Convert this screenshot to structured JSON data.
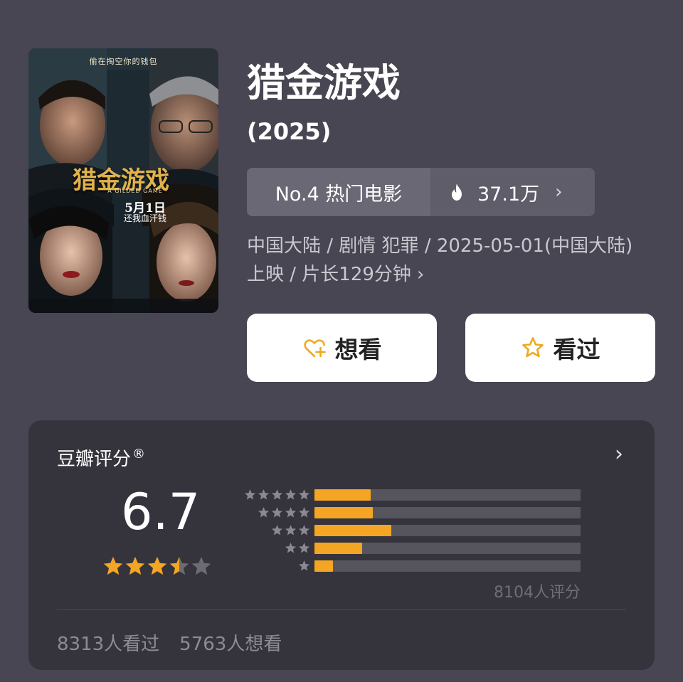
{
  "movie": {
    "title": "猎金游戏",
    "year": "(2025)",
    "poster": {
      "tagline": "偷在掏空你的钱包",
      "title": "猎金游戏",
      "english_title": "A GILDED GAME",
      "release": "5月1日",
      "release_sub": "还我血汗钱"
    },
    "rank": {
      "label": "No.4 热门电影",
      "heat_value": "37.1万",
      "heat_icon": "flame-icon",
      "chevron": "›"
    },
    "meta_text": "中国大陆 / 剧情 犯罪 / 2025-05-01(中国大陆)上映 / 片长129分钟",
    "meta_chevron": "›",
    "actions": {
      "want_label": "想看",
      "want_icon": "heart-plus-icon",
      "seen_label": "看过",
      "seen_icon": "star-outline-icon"
    }
  },
  "rating": {
    "title": "豆瓣评分",
    "registered_mark": "®",
    "chevron": "›",
    "score": "6.7",
    "stars_value": 3.5,
    "distribution": [
      {
        "stars": 5,
        "fraction": 0.21
      },
      {
        "stars": 4,
        "fraction": 0.22
      },
      {
        "stars": 3,
        "fraction": 0.29
      },
      {
        "stars": 2,
        "fraction": 0.18
      },
      {
        "stars": 1,
        "fraction": 0.07
      }
    ],
    "count_text": "8104人评分",
    "seen_count": "8313人看过",
    "want_count": "5763人想看"
  },
  "colors": {
    "background": "#484652",
    "card": "#35343c",
    "accent": "#f5a524",
    "star_empty": "#6c6b74",
    "bar_track": "#56555d"
  }
}
